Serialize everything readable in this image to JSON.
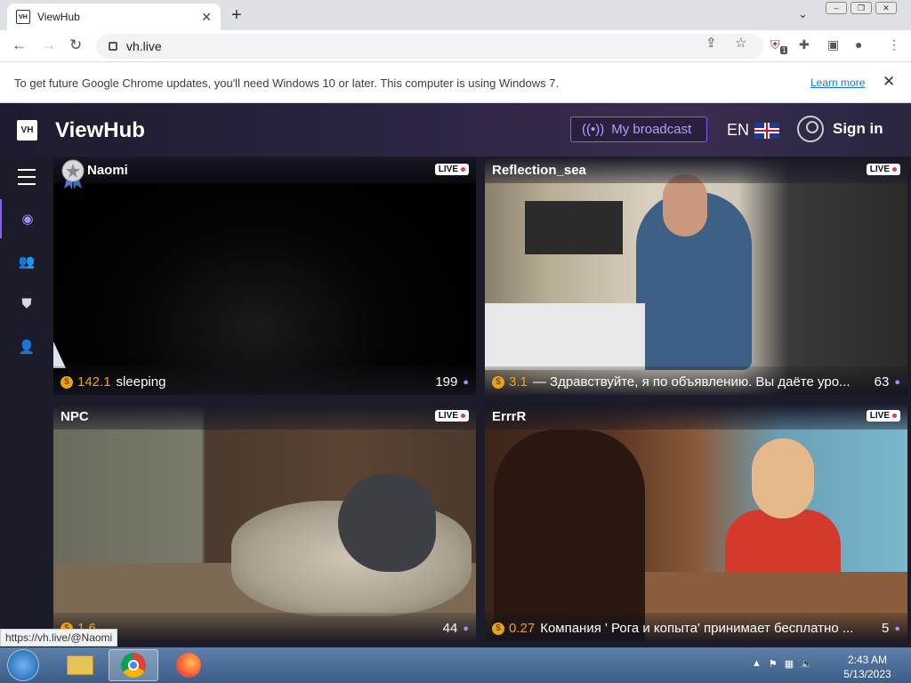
{
  "browser": {
    "tab_title": "ViewHub",
    "tab_favicon_text": "VH",
    "url": "vh.live",
    "extension_badge": "1",
    "status_url": "https://vh.live/@Naomi"
  },
  "infobar": {
    "message": "To get future Google Chrome updates, you'll need Windows 10 or later. This computer is using Windows 7.",
    "learn_more": "Learn more"
  },
  "site": {
    "logo_text": "VH",
    "brand": "ViewHub",
    "broadcast_label": "My broadcast",
    "language": "EN",
    "signin_label": "Sign in"
  },
  "streams": [
    {
      "name": "Naomi",
      "live": "LIVE",
      "tips": "142.1",
      "topic": "sleeping",
      "viewers": "199"
    },
    {
      "name": "Reflection_sea",
      "live": "LIVE",
      "tips": "3.1",
      "topic": "— Здравствуйте, я по объявлению. Вы даёте уро...",
      "viewers": "63"
    },
    {
      "name": "NPC",
      "live": "LIVE",
      "tips": "1.6",
      "topic": "",
      "viewers": "44"
    },
    {
      "name": "ErrrR",
      "live": "LIVE",
      "tips": "0.27",
      "topic": "Компания ' Рога и копыта' принимает бесплатно ...",
      "viewers": "5"
    }
  ],
  "taskbar": {
    "time": "2:43 AM",
    "date": "5/13/2023"
  },
  "colors": {
    "accent": "#8b5cf6",
    "tips": "#f0a21b",
    "header_bg": "#1c1c2e",
    "page_bg": "#1b1b2a"
  }
}
